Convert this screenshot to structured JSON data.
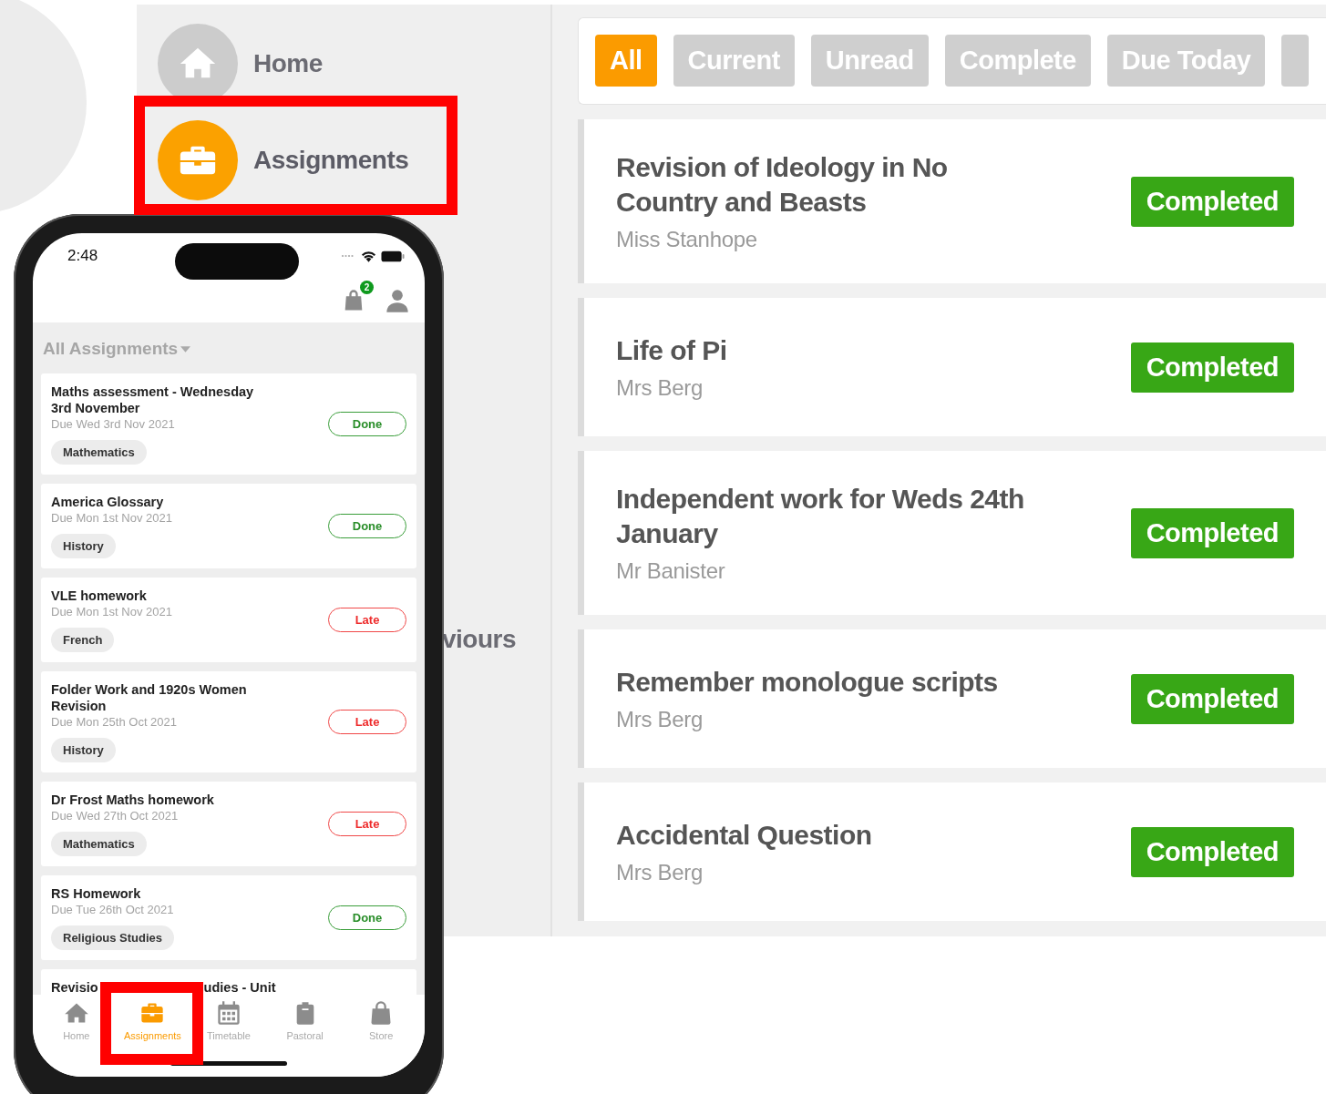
{
  "desktop": {
    "sidebar": [
      {
        "label": "Home",
        "selected": false
      },
      {
        "label": "Assignments",
        "selected": true
      },
      {
        "label": "viours",
        "selected": false
      }
    ],
    "filters": [
      {
        "label": "All",
        "selected": true
      },
      {
        "label": "Current",
        "selected": false
      },
      {
        "label": "Unread",
        "selected": false
      },
      {
        "label": "Complete",
        "selected": false
      },
      {
        "label": "Due Today",
        "selected": false
      }
    ],
    "assignments": [
      {
        "title": "Revision of Ideology in No Country and Beasts",
        "teacher": "Miss Stanhope",
        "status": "Completed"
      },
      {
        "title": "Life of Pi",
        "teacher": "Mrs Berg",
        "status": "Completed"
      },
      {
        "title": "Independent work for Weds 24th January",
        "teacher": "Mr Banister",
        "status": "Completed"
      },
      {
        "title": "Remember monologue scripts",
        "teacher": "Mrs Berg",
        "status": "Completed"
      },
      {
        "title": "Accidental Question",
        "teacher": "Mrs Berg",
        "status": "Completed"
      }
    ]
  },
  "phone": {
    "time": "2:48",
    "badge": "2",
    "heading": "All Assignments",
    "assignments": [
      {
        "title": "Maths assessment - Wednesday 3rd November",
        "due": "Due Wed 3rd Nov 2021",
        "subject": "Mathematics",
        "status": "Done",
        "kind": "done"
      },
      {
        "title": "America Glossary",
        "due": "Due Mon 1st Nov 2021",
        "subject": "History",
        "status": "Done",
        "kind": "done"
      },
      {
        "title": "VLE homework",
        "due": "Due Mon 1st Nov 2021",
        "subject": "French",
        "status": "Late",
        "kind": "late"
      },
      {
        "title": "Folder Work and 1920s Women Revision",
        "due": "Due Mon 25th Oct 2021",
        "subject": "History",
        "status": "Late",
        "kind": "late"
      },
      {
        "title": "Dr Frost Maths homework",
        "due": "Due Wed 27th Oct 2021",
        "subject": "Mathematics",
        "status": "Late",
        "kind": "late"
      },
      {
        "title": "RS Homework",
        "due": "Due Tue 26th Oct 2021",
        "subject": "Religious Studies",
        "status": "Done",
        "kind": "done"
      }
    ],
    "partial_item": {
      "title_start": "Revisio",
      "title_end": "udies - Unit"
    },
    "tabs": [
      {
        "label": "Home",
        "selected": false
      },
      {
        "label": "Assignments",
        "selected": true
      },
      {
        "label": "Timetable",
        "selected": false
      },
      {
        "label": "Pastoral",
        "selected": false
      },
      {
        "label": "Store",
        "selected": false
      }
    ]
  }
}
